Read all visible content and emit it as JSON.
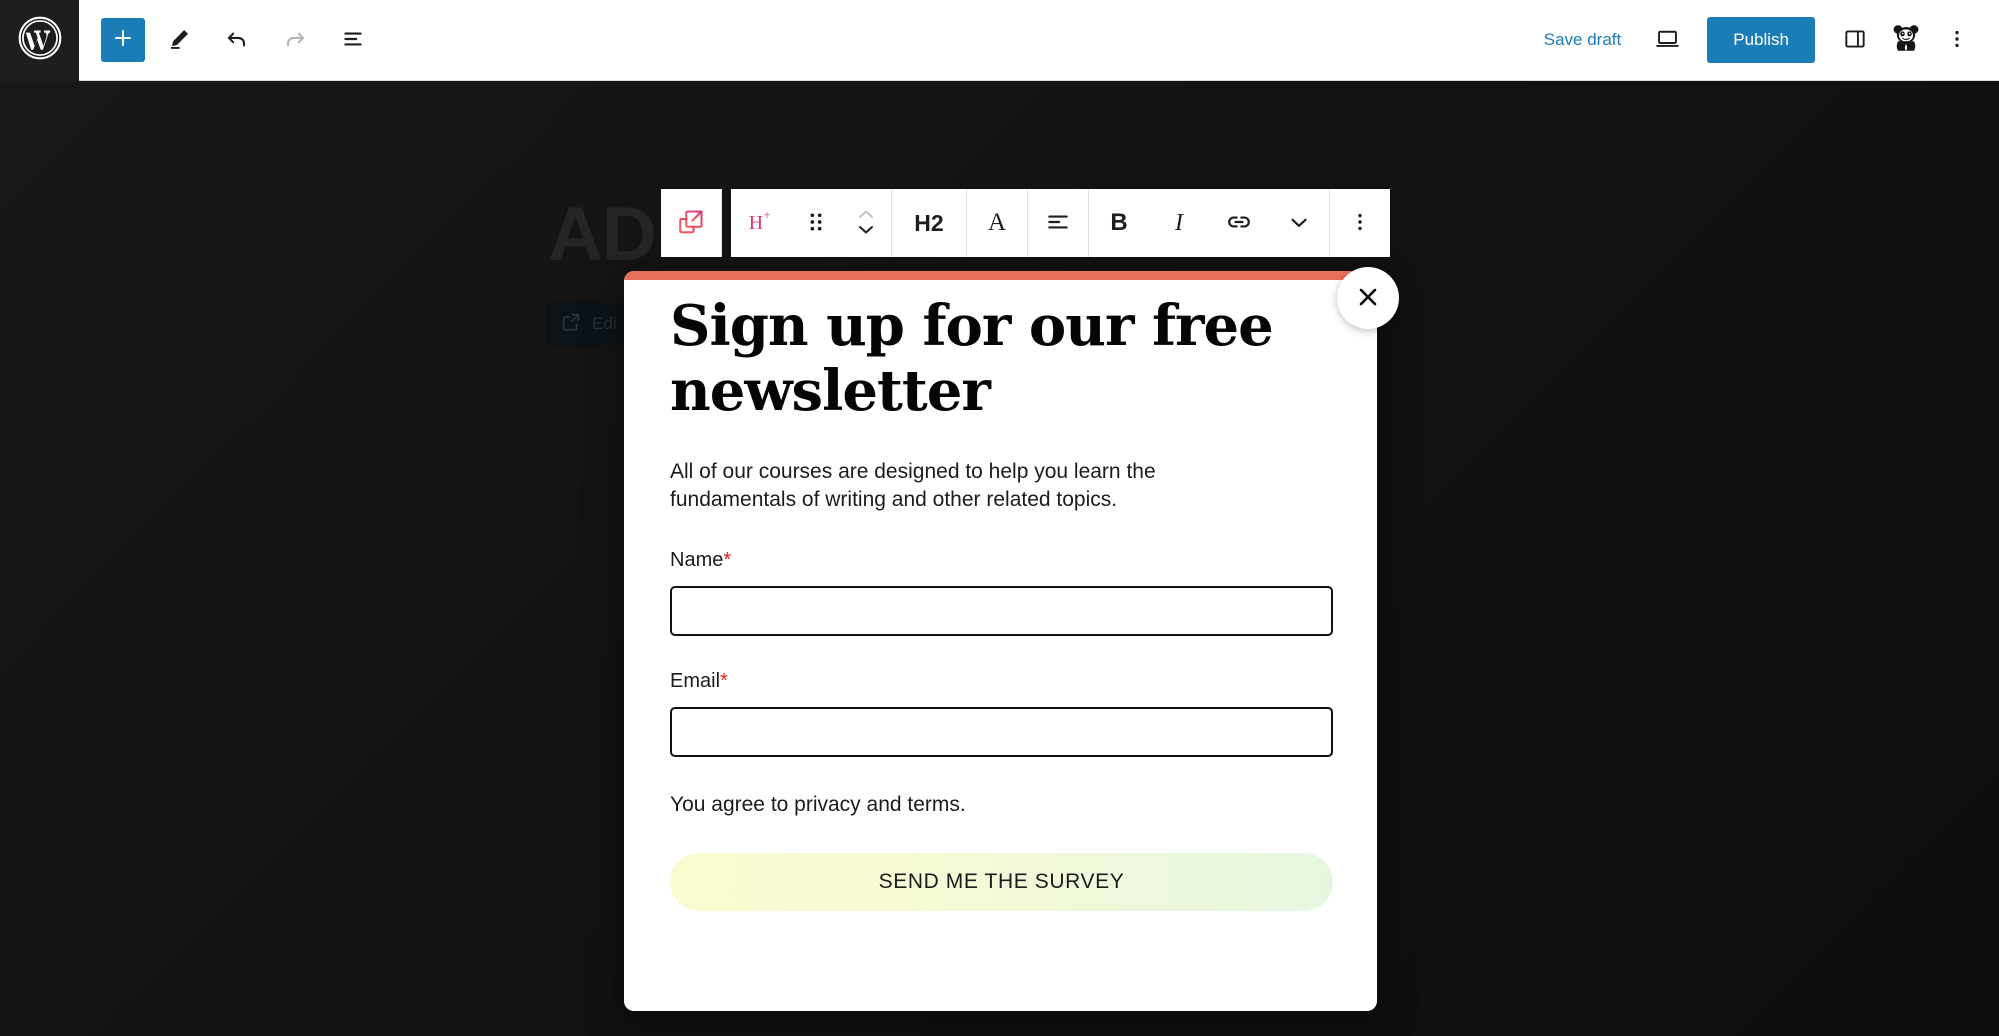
{
  "header": {
    "logo_icon": "wordpress-logo-icon",
    "add_block_icon": "plus-icon",
    "tools_icon": "pencil-edit-icon",
    "undo_icon": "undo-arrow-icon",
    "redo_icon": "redo-arrow-icon",
    "details_icon": "document-outline-icon",
    "save_draft_label": "Save draft",
    "preview_icon": "desktop-preview-icon",
    "publish_label": "Publish",
    "settings_icon": "sidebar-panel-icon",
    "avatar_icon": "panda-avatar-icon",
    "options_icon": "three-dots-vertical-icon"
  },
  "canvas": {
    "backdrop_heading": "AD",
    "edit_popup_badge": {
      "icon": "popup-external-icon",
      "label": "Edi"
    }
  },
  "block_toolbar": {
    "popup_block_icon": "popup-block-icon",
    "items": [
      {
        "name": "transform-heading",
        "label": "H",
        "sup": "+",
        "icon": "heading-transform-icon"
      },
      {
        "name": "drag-handle",
        "icon": "drag-dots-icon"
      },
      {
        "name": "move-updown",
        "icon": "move-up-down-icon"
      },
      {
        "name": "heading-level",
        "label": "H2",
        "icon": "heading-level-icon"
      },
      {
        "name": "text-color",
        "label": "A",
        "icon": "text-color-icon"
      },
      {
        "name": "align-text",
        "icon": "align-left-icon"
      },
      {
        "name": "bold",
        "label": "B",
        "icon": "bold-icon"
      },
      {
        "name": "italic",
        "label": "I",
        "icon": "italic-icon"
      },
      {
        "name": "link",
        "icon": "link-icon"
      },
      {
        "name": "more-formats",
        "icon": "chevron-down-icon"
      },
      {
        "name": "block-options",
        "icon": "three-dots-vertical-icon"
      }
    ]
  },
  "popup_modal": {
    "accent_color": "#E8705A",
    "heading": "Sign up for our free newsletter",
    "description": "All of our courses are designed to help you learn the fundamentals of writing and other related topics.",
    "fields": [
      {
        "label": "Name",
        "required_marker": "*",
        "value": "",
        "placeholder": ""
      },
      {
        "label": "Email",
        "required_marker": "*",
        "value": "",
        "placeholder": ""
      }
    ],
    "privacy_note": "You agree to privacy and terms.",
    "submit_label": "SEND ME THE SURVEY",
    "close_icon": "close-x-icon"
  },
  "colors": {
    "accent_blue": "#1a7db5",
    "modal_accent": "#E8705A",
    "required_red": "#e02020",
    "canvas_dark": "#121212"
  }
}
